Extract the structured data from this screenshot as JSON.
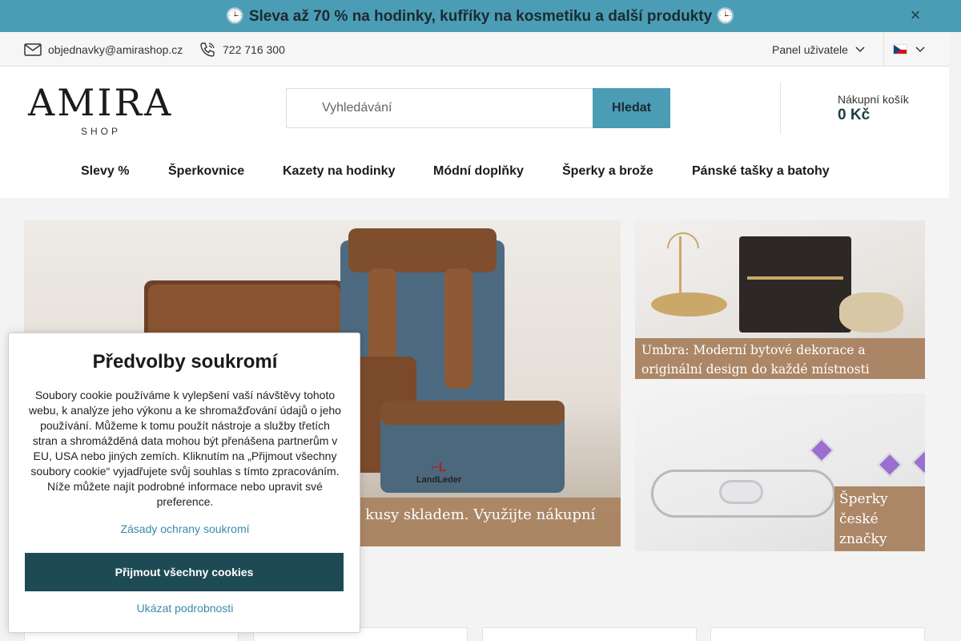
{
  "promo": {
    "text": "🕒 Sleva až 70 % na hodinky, kufříky na kosmetiku a další produkty 🕒",
    "close_icon": "×"
  },
  "contact": {
    "email": "objednavky@amirashop.cz",
    "phone": "722 716 300",
    "user_panel": "Panel uživatele",
    "user_icon": "",
    "language": "CZ flag"
  },
  "logo": {
    "main": "AMIRA",
    "sub": "SHOP"
  },
  "search": {
    "placeholder": "Vyhledávání",
    "icon": "",
    "button": "Hledat"
  },
  "cart": {
    "icon": "",
    "label": "Nákupní košík",
    "total": "0 Kč"
  },
  "nav": {
    "items": [
      "Slevy %",
      "Šperkovnice",
      "Kazety na hodinky",
      "Módní doplňky",
      "Šperky a brože",
      "Pánské tašky a batohy"
    ],
    "more_icon": ""
  },
  "banners": {
    "main_caption": "FINÁLNÍ DOPRODEJ LANDLEDER. Poslední kusy skladem. Využijte nákupní ceny, dokud jsou produkty skladem.",
    "brand": "LandLeder",
    "side1_caption": "Umbra: Moderní bytové dekorace a originální design do každé místnosti",
    "side2_caption": "Šperky české značky MINET"
  },
  "cookie": {
    "title": "Předvolby soukromí",
    "text": "Soubory cookie používáme k vylepšení vaší návštěvy tohoto webu, k analýze jeho výkonu a ke shromažďování údajů o jeho používání. Můžeme k tomu použít nástroje a služby třetích stran a shromážděná data mohou být přenášena partnerům v EU, USA nebo jiných zemích. Kliknutím na „Přijmout všechny soubory cookie“ vyjadřujete svůj souhlas s tímto zpracováním. Níže můžete najít podrobné informace nebo upravit své preference.",
    "privacy_link": "Zásady ochrany soukromí",
    "accept_button": "Přijmout všechny cookies",
    "details_link": "Ukázat podrobnosti"
  },
  "colors": {
    "accent": "#4a9db4",
    "dark": "#1e4a55",
    "caption_bg": "#a88260",
    "link": "#3a8aa6"
  }
}
